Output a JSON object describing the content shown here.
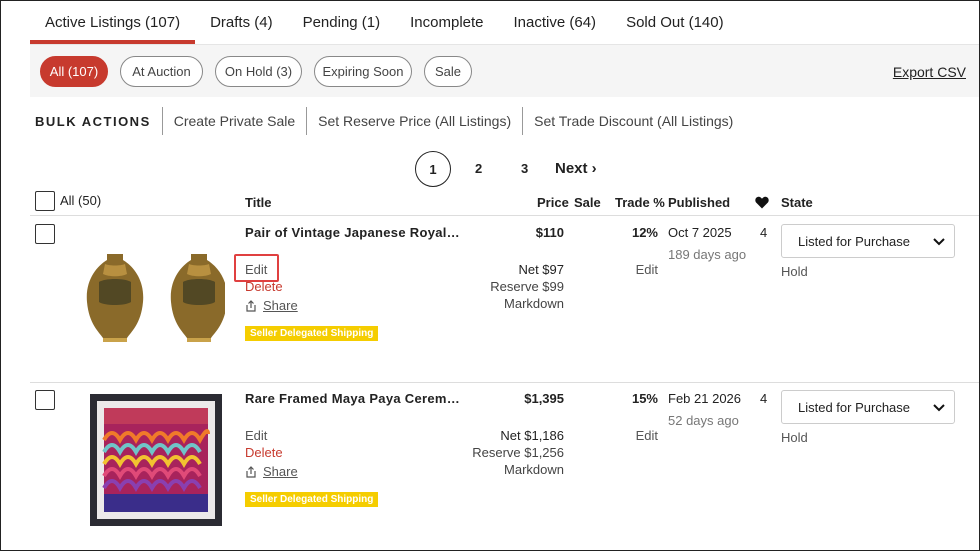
{
  "tabs": [
    {
      "label": "Active Listings (107)"
    },
    {
      "label": "Drafts (4)"
    },
    {
      "label": "Pending (1)"
    },
    {
      "label": "Incomplete"
    },
    {
      "label": "Inactive (64)"
    },
    {
      "label": "Sold Out (140)"
    }
  ],
  "filters": [
    {
      "label": "All (107)"
    },
    {
      "label": "At Auction"
    },
    {
      "label": "On Hold (3)"
    },
    {
      "label": "Expiring Soon"
    },
    {
      "label": "Sale"
    }
  ],
  "export_label": "Export CSV",
  "bulk": {
    "title": "BULK ACTIONS",
    "items": [
      {
        "label": "Create Private Sale"
      },
      {
        "label": "Set Reserve Price (All Listings)"
      },
      {
        "label": "Set Trade Discount (All Listings)"
      }
    ]
  },
  "pagination": {
    "pages": [
      "1",
      "2",
      "3"
    ],
    "current": "1",
    "next_label": "Next ›"
  },
  "table": {
    "select_all_label": "All (50)",
    "headers": {
      "title": "Title",
      "price": "Price",
      "sale": "Sale",
      "trade": "Trade %",
      "published": "Published",
      "state": "State"
    },
    "rows": [
      {
        "title": "Pair of Vintage Japanese Royal…",
        "edit": "Edit",
        "delete": "Delete",
        "share": "Share",
        "badge": "Seller Delegated Shipping",
        "price": "$110",
        "net": "Net $97",
        "reserve": "Reserve $99",
        "markdown": "Markdown",
        "trade": "12%",
        "trade_edit": "Edit",
        "published": "Oct 7 2025",
        "ago": "189 days ago",
        "likes": "4",
        "state": "Listed for Purchase",
        "hold": "Hold"
      },
      {
        "title": "Rare Framed Maya Paya Cerem…",
        "edit": "Edit",
        "delete": "Delete",
        "share": "Share",
        "badge": "Seller Delegated Shipping",
        "price": "$1,395",
        "net": "Net $1,186",
        "reserve": "Reserve $1,256",
        "markdown": "Markdown",
        "trade": "15%",
        "trade_edit": "Edit",
        "published": "Feb 21 2026",
        "ago": "52 days ago",
        "likes": "4",
        "state": "Listed for Purchase",
        "hold": "Hold"
      }
    ]
  },
  "colors": {
    "accent": "#c73a2e",
    "badge": "#f5cd00"
  }
}
